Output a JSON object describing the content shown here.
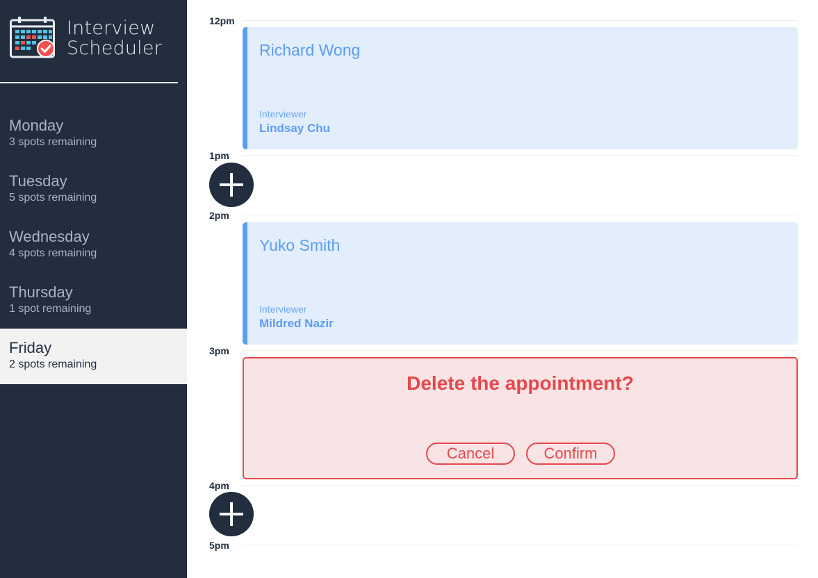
{
  "app": {
    "title_line1": "Interview",
    "title_line2": "Scheduler",
    "logo_icon": "calendar-check-icon"
  },
  "sidebar": {
    "days": [
      {
        "name": "Monday",
        "spots": "3 spots remaining",
        "selected": false
      },
      {
        "name": "Tuesday",
        "spots": "5 spots remaining",
        "selected": false
      },
      {
        "name": "Wednesday",
        "spots": "4 spots remaining",
        "selected": false
      },
      {
        "name": "Thursday",
        "spots": "1 spot remaining",
        "selected": false
      },
      {
        "name": "Friday",
        "spots": "2 spots remaining",
        "selected": true
      }
    ]
  },
  "schedule": {
    "times": [
      "12pm",
      "1pm",
      "2pm",
      "3pm",
      "4pm",
      "5pm"
    ],
    "appointments": [
      {
        "time": "12pm",
        "student": "Richard Wong",
        "interviewer_label": "Interviewer",
        "interviewer": "Lindsay Chu"
      },
      {
        "time": "2pm",
        "student": "Yuko Smith",
        "interviewer_label": "Interviewer",
        "interviewer": "Mildred Nazir"
      }
    ],
    "empty_slots": [
      "1pm",
      "4pm"
    ],
    "confirm": {
      "time": "3pm",
      "message": "Delete the appointment?",
      "cancel_label": "Cancel",
      "confirm_label": "Confirm"
    }
  },
  "colors": {
    "sidebar_bg": "#222d3e",
    "accent_blue": "#5d9cf0",
    "appointment_bg": "#e3eefc",
    "danger": "#e5484d",
    "danger_bg": "#f8e4e4"
  }
}
